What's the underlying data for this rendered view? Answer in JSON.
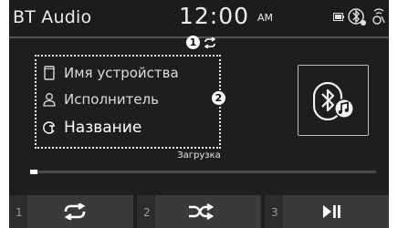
{
  "status_bar": {
    "app_title": "BT Audio",
    "time": "12:00",
    "ampm": "AM"
  },
  "callouts": [
    "1",
    "2"
  ],
  "track_info": {
    "device_name": "Имя устройства",
    "artist": "Исполнитель",
    "title": "Название"
  },
  "loading_text": "Загрузка",
  "progress": {
    "fraction": 0.02
  },
  "controls": [
    {
      "number": "1",
      "icon": "repeat-icon"
    },
    {
      "number": "2",
      "icon": "shuffle-icon"
    },
    {
      "number": "3",
      "icon": "play-pause-icon"
    }
  ],
  "colors": {
    "background": "#1e1e1e",
    "control_bar": "#3a3a3a",
    "text": "#ededed"
  }
}
